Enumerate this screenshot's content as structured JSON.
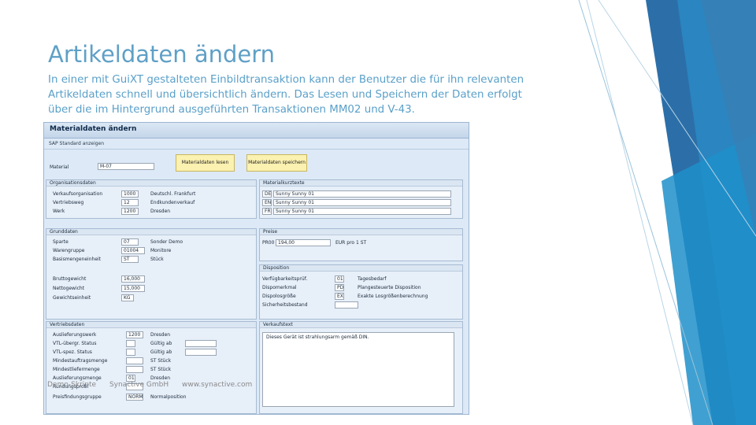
{
  "slide": {
    "title": "Artikeldaten ändern",
    "body_lines": [
      "In einer mit GuiXT gestalteten Einbildtransaktion kann der Benutzer die für ihn relevanten",
      "Artikeldaten schnell und übersichtlich ändern. Das Lesen und Speichern der Daten erfolgt",
      "über die im Hintergrund ausgeführten Transaktionen MM02 und V-43."
    ],
    "footer": {
      "left": "Demo-Skripte",
      "company": "Synactive GmbH",
      "url": "www.synactive.com"
    }
  },
  "sap": {
    "title": "Materialdaten ändern",
    "menu": "SAP Standard anzeigen",
    "material_label": "Material",
    "material_value": "M-07",
    "btn_load": "Materialdaten lesen",
    "btn_save": "Materialdaten speichern",
    "org": {
      "header": "Organisationsdaten",
      "rows": [
        {
          "label": "Verkaufsorganisation",
          "code": "1000",
          "text": "Deutschl. Frankfurt"
        },
        {
          "label": "Vertriebsweg",
          "code": "12",
          "text": "Endkundenverkauf"
        },
        {
          "label": "Werk",
          "code": "1200",
          "text": "Dresden"
        }
      ]
    },
    "desc": {
      "header": "Materialkurztexte",
      "rows": [
        {
          "lang": "DE",
          "text": "Sunny Sunny 01"
        },
        {
          "lang": "EN",
          "text": "Sunny Sunny 01"
        },
        {
          "lang": "FR",
          "text": "Sunny Sunny 01"
        }
      ]
    },
    "basic": {
      "header": "Grunddaten",
      "rows": [
        {
          "label": "Sparte",
          "code": "07",
          "text": "Sonder Demo"
        },
        {
          "label": "Warengruppe",
          "code": "01004",
          "text": "Monitore"
        },
        {
          "label": "Basismengeneinheit",
          "code": "ST",
          "text": "Stück"
        },
        {
          "label": "Bruttogewicht",
          "code": "16,000",
          "text": ""
        },
        {
          "label": "Nettogewicht",
          "code": "15,000",
          "text": ""
        },
        {
          "label": "Gewichtseinheit",
          "code": "KG",
          "text": ""
        }
      ]
    },
    "prices": {
      "header": "Preise",
      "cond": "PR00",
      "amount": "194,00",
      "unit": "EUR pro 1 ST"
    },
    "dispo": {
      "header": "Disposition",
      "rows": [
        {
          "label": "Verfügbarkeitsprüf.",
          "code": "01",
          "text": "Tagesbedarf"
        },
        {
          "label": "Dispomerkmal",
          "code": "PD",
          "text": "Plangesteuerte Disposition"
        },
        {
          "label": "Dispolosgröße",
          "code": "EX",
          "text": "Exakte Losgrößenberechnung"
        },
        {
          "label": "Sicherheitsbestand",
          "code": "",
          "text": ""
        }
      ]
    },
    "sales": {
      "header": "Vertriebsdaten",
      "rows": [
        {
          "label": "Auslieferungswerk",
          "code": "1200",
          "text": "Dresden"
        },
        {
          "label": "VTL-übergr. Status",
          "code": "",
          "text": "Gültig ab"
        },
        {
          "label": "VTL-spez. Status",
          "code": "",
          "text": "Gültig ab"
        },
        {
          "label": "Mindestauftragsmenge",
          "code": "",
          "text": "ST  Stück"
        },
        {
          "label": "Mindestliefermenge",
          "code": "",
          "text": "ST  Stück"
        },
        {
          "label": "Auslieferungsmenge",
          "code": "01",
          "text": "Dresden"
        },
        {
          "label": "Rundungsprofil",
          "code": "",
          "text": ""
        },
        {
          "label": "Preisfindungsgruppe",
          "code": "NORM",
          "text": "Normalposition"
        }
      ]
    },
    "salestext": {
      "header": "Verkaufstext",
      "text": "Dieses Gerät ist strahlungsarm gemäß DIN."
    }
  }
}
